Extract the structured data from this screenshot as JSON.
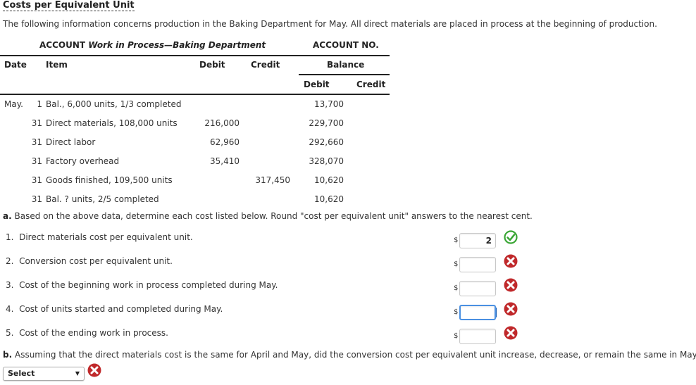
{
  "title": "Costs per Equivalent Unit",
  "intro": "The following information concerns production in the Baking Department for May. All direct materials are placed in process at the beginning of production.",
  "account": {
    "prefix": "ACCOUNT",
    "name": "Work in Process—Baking Department",
    "number_label": "ACCOUNT NO."
  },
  "ledger": {
    "headers": {
      "date": "Date",
      "item": "Item",
      "debit": "Debit",
      "credit": "Credit",
      "balance": "Balance",
      "balance_debit": "Debit",
      "balance_credit": "Credit"
    },
    "rows": [
      {
        "month": "May.",
        "day": "1",
        "item": "Bal., 6,000 units, 1/3 completed",
        "debit": "",
        "credit": "",
        "balance_debit": "13,700",
        "balance_credit": ""
      },
      {
        "month": "",
        "day": "31",
        "item": "Direct materials, 108,000 units",
        "debit": "216,000",
        "credit": "",
        "balance_debit": "229,700",
        "balance_credit": ""
      },
      {
        "month": "",
        "day": "31",
        "item": "Direct labor",
        "debit": "62,960",
        "credit": "",
        "balance_debit": "292,660",
        "balance_credit": ""
      },
      {
        "month": "",
        "day": "31",
        "item": "Factory overhead",
        "debit": "35,410",
        "credit": "",
        "balance_debit": "328,070",
        "balance_credit": ""
      },
      {
        "month": "",
        "day": "31",
        "item": "Goods finished, 109,500 units",
        "debit": "",
        "credit": "317,450",
        "balance_debit": "10,620",
        "balance_credit": ""
      },
      {
        "month": "",
        "day": "31",
        "item": "Bal. ? units, 2/5 completed",
        "debit": "",
        "credit": "",
        "balance_debit": "10,620",
        "balance_credit": ""
      }
    ]
  },
  "part_a": {
    "label": "a.",
    "instruction": "Based on the above data, determine each cost listed below. Round \"cost per equivalent unit\" answers to the nearest cent.",
    "currency": "$",
    "questions": [
      {
        "text": "1.  Direct materials cost per equivalent unit.",
        "value": "2",
        "status": "correct"
      },
      {
        "text": "2.  Conversion cost per equivalent unit.",
        "value": "",
        "status": "incorrect"
      },
      {
        "text": "3.  Cost of the beginning work in process completed during May.",
        "value": "",
        "status": "incorrect"
      },
      {
        "text": "4.  Cost of units started and completed during May.",
        "value": "",
        "status": "incorrect"
      },
      {
        "text": "5.  Cost of the ending work in process.",
        "value": "",
        "status": "incorrect"
      }
    ]
  },
  "part_b": {
    "label": "b.",
    "question": "Assuming that the direct materials cost is the same for April and May, did the conversion cost per equivalent unit increase, decrease, or remain the same in May?",
    "select_value": "Select",
    "status": "incorrect"
  },
  "colors": {
    "correct": "#3aa635",
    "incorrect": "#c0292b",
    "focus": "#4a90e2"
  }
}
